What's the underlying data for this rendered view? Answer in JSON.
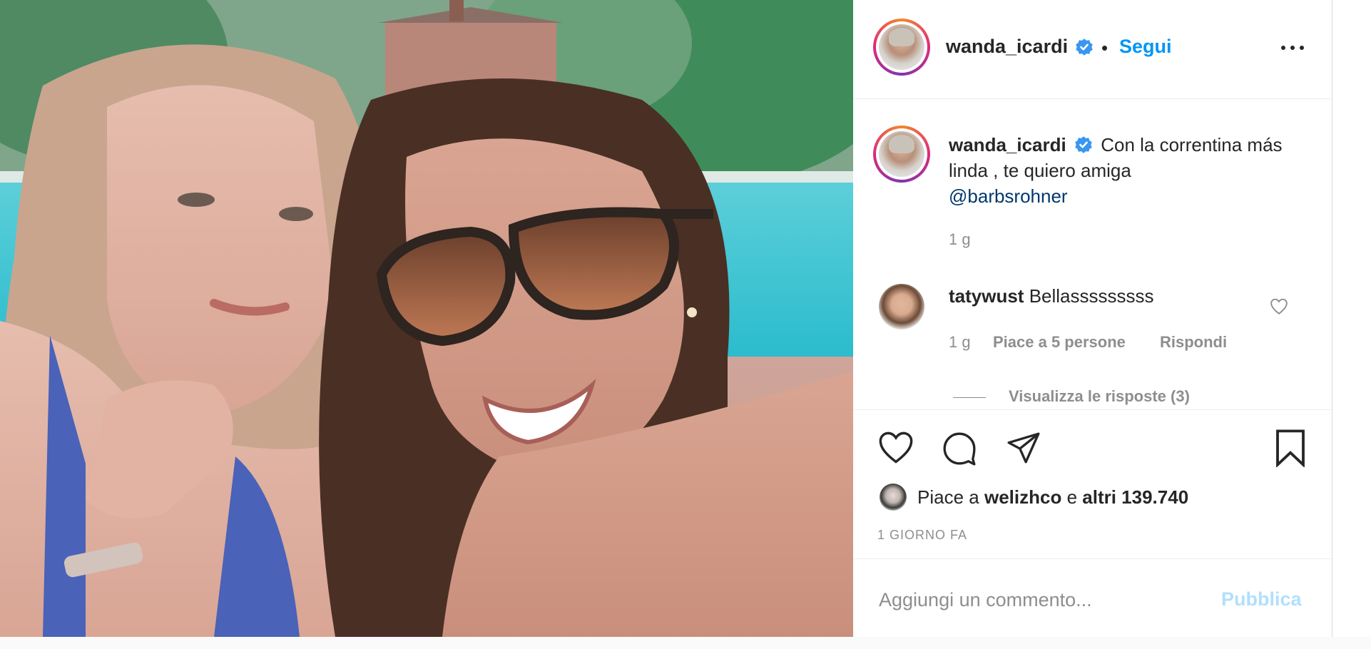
{
  "post": {
    "username": "wanda_icardi",
    "dot": "•",
    "follow_label": "Segui",
    "caption_text": "Con la correntina más linda , te quiero amiga",
    "caption_mention": "@barbsrohner",
    "caption_time": "1 g"
  },
  "comments": [
    {
      "username": "tatywust",
      "text": "Bellasssssssss",
      "time": "1 g",
      "likes": "Piace a 5 persone",
      "reply_label": "Rispondi",
      "view_replies": "Visualizza le risposte (3)"
    }
  ],
  "likes": {
    "prefix": "Piace a",
    "user": "welizhco",
    "joiner": "e",
    "others": "altri 139.740"
  },
  "post_time": "1 GIORNO FA",
  "comment_form": {
    "placeholder": "Aggiungi un commento...",
    "publish_label": "Pubblica"
  },
  "icons": {
    "verified": "verified-badge-icon",
    "more": "more-options-icon",
    "like": "heart-icon",
    "comment": "comment-bubble-icon",
    "share": "paper-plane-icon",
    "save": "bookmark-icon"
  },
  "colors": {
    "accent_blue": "#0095f6",
    "mention_blue": "#00376b",
    "muted": "#8e8e8e",
    "publish_disabled": "#b2dffc"
  }
}
